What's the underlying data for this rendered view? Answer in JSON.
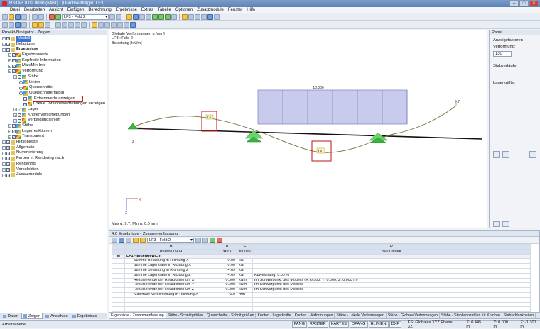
{
  "app": {
    "title": "RSTAB 8.02.0030 (64bit) - [Durchlaufträger, LF3]"
  },
  "menu": [
    "Datei",
    "Bearbeiten",
    "Ansicht",
    "Einfügen",
    "Berechnung",
    "Ergebnisse",
    "Extras",
    "Tabelle",
    "Optionen",
    "Zusatzmodule",
    "Fenster",
    "Hilfe"
  ],
  "toolbar": {
    "loadcase": "LF3 - Feld 2"
  },
  "navigator": {
    "title": "Projekt-Navigator - Zeigen",
    "items": [
      {
        "label": "Modell",
        "depth": 0,
        "sel": true
      },
      {
        "label": "Belastung",
        "depth": 0
      },
      {
        "label": "Ergebnisse",
        "depth": 0,
        "bold": true
      },
      {
        "label": "Ergebniswerte",
        "depth": 1
      },
      {
        "label": "Kopfzeile-Information",
        "depth": 1
      },
      {
        "label": "Max/Min-Info",
        "depth": 1
      },
      {
        "label": "Verformung",
        "depth": 1
      },
      {
        "label": "Stäbe",
        "depth": 2
      },
      {
        "label": "Linien",
        "depth": 3,
        "radio": true
      },
      {
        "label": "Querschnitte",
        "depth": 3,
        "radio": true
      },
      {
        "label": "Querschnitte farbig",
        "depth": 3,
        "radio": true
      },
      {
        "label": "Extremwerte anzeigen",
        "depth": 3,
        "boxed": true
      },
      {
        "label": "Lokale Torsionsverdrehungen anzeigen",
        "depth": 3
      },
      {
        "label": "Lager",
        "depth": 2
      },
      {
        "label": "Knotenverschiebungen",
        "depth": 2
      },
      {
        "label": "Verbindungslinien",
        "depth": 2
      },
      {
        "label": "Stäbe",
        "depth": 1
      },
      {
        "label": "Lagerreaktionen",
        "depth": 1
      },
      {
        "label": "Transparent",
        "depth": 1
      },
      {
        "label": "Hilfsobjekte",
        "depth": 0
      },
      {
        "label": "Allgemein",
        "depth": 0
      },
      {
        "label": "Nummerierung",
        "depth": 0
      },
      {
        "label": "Farben in Rendering nach",
        "depth": 0
      },
      {
        "label": "Rendering",
        "depth": 0
      },
      {
        "label": "Vorselektion",
        "depth": 0
      },
      {
        "label": "Zusatzmodule",
        "depth": 0
      }
    ],
    "tabs": [
      "Daten",
      "Zeigen",
      "Ansichten",
      "Ergebnisse"
    ]
  },
  "view": {
    "caption": [
      "Globale Verformungen u [mm]",
      "LF3 : Feld 2",
      "Belastung [kN/m]"
    ],
    "load_value": "10.000",
    "end_value": "9.7",
    "left_value": "2.6",
    "max_value": "4.6",
    "bottom": "Max u: 9.7, Min u: 0.0 mm",
    "axis": {
      "x": "X",
      "z": "Z"
    }
  },
  "panel": {
    "title": "Panel",
    "factors_label": "Anzeigefaktoren",
    "deform_label": "Verformung:",
    "deform_value": "130",
    "bar_label": "Stabverläufe:",
    "support_label": "Lagerkräfte:"
  },
  "table": {
    "title": "4.0 Ergebnisse - Zusammenfassung",
    "combo": "LF3 - Feld 2",
    "col_letters": [
      "A",
      "B",
      "C",
      "D"
    ],
    "headers": [
      "Bezeichnung",
      "Wert",
      "Einheit",
      "Kommentar"
    ],
    "group": "LF1 - Eigengewicht",
    "rows": [
      [
        "Summe Belastung in Richtung X",
        "0.00",
        "kN",
        ""
      ],
      [
        "Summe Lagerkräfte in Richtung X",
        "0.00",
        "kN",
        ""
      ],
      [
        "Summe Belastung in Richtung Z",
        "4.69",
        "kN",
        ""
      ],
      [
        "Summe Lagerkräfte in Richtung Z",
        "4.69",
        "kN",
        "Abweichung:  0.00 %"
      ],
      [
        "Resultierende der Reaktionen um X",
        "0.000",
        "kNm",
        "Im Schwerpunkt des Modells (X: 6.500, Y: 0.000, Z: 0.000 m)"
      ],
      [
        "Resultierende der Reaktionen um Y",
        "0.000",
        "kNm",
        "Im Schwerpunkt des Modells"
      ],
      [
        "Resultierende der Reaktionen um Z",
        "0.000",
        "kNm",
        "Im Schwerpunkt des Modells"
      ],
      [
        "Maximale Verschiebung in Richtung X",
        "0.0",
        "mm",
        ""
      ]
    ],
    "tabs": [
      "Ergebnisse - Zusammenfassung",
      "Stäbe - Schnittgrößen",
      "Querschnitte - Schnittgrößen",
      "Knoten - Lagerkräfte",
      "Knoten - Verformungen",
      "Stäbe - Lokale Verformungen",
      "Stäbe - Globale Verformungen",
      "Stäbe - Stabkennzahlen für Knicken",
      "Stabschlankheiten"
    ]
  },
  "status": {
    "left": "Arbeitsebene",
    "buttons": [
      "FANG",
      "RASTER",
      "KARTES",
      "OFANG",
      "HLINIEN",
      "DXF"
    ],
    "coords": [
      "KS: Globales XYZ Ebene: XZ",
      "X:  0.445 m",
      "Y:  0.000 m",
      "Z:  -1.307 m"
    ]
  }
}
